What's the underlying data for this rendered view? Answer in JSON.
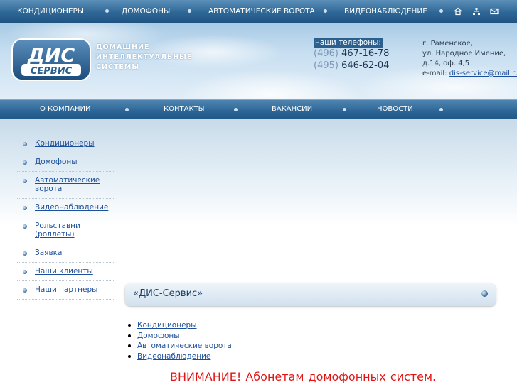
{
  "top_nav": {
    "items": [
      "КОНДИЦИОНЕРЫ",
      "ДОМОФОНЫ",
      "АВТОМАТИЧЕСКИЕ ВОРОТА",
      "ВИДЕОНАБЛЮДЕНИЕ"
    ],
    "icons": [
      "home-icon",
      "sitemap-icon",
      "mail-icon"
    ]
  },
  "header": {
    "logo_text_top": "ДИС",
    "logo_text_bottom": "СЕРВИС",
    "tagline": [
      "ДОМАШНИЕ",
      "ИНТЕЛЛЕКТУАЛЬНЫЕ",
      "СИСТЕМЫ"
    ],
    "phones_label": "наши телефоны:",
    "phones": [
      {
        "code": "(496)",
        "number": "467-16-78"
      },
      {
        "code": "(495)",
        "number": "646-62-04"
      }
    ],
    "address": [
      "г. Раменское,",
      "ул. Народное Имение,",
      "д.14, оф. 4,5"
    ],
    "email_label": "e-mail:",
    "email": "dis-service@mail.ru"
  },
  "sub_nav": {
    "items": [
      "О КОМПАНИИ",
      "КОНТАКТЫ",
      "ВАКАНСИИ",
      "НОВОСТИ"
    ]
  },
  "sidebar": {
    "items": [
      "Кондиционеры",
      "Домофоны",
      "Автоматические ворота",
      "Видеонаблюдение",
      "Рольставни (роллеты)",
      "Заявка",
      "Наши клиенты",
      "Наши партнеры"
    ]
  },
  "main": {
    "section_title": "«ДИС-Сервис»",
    "links": [
      "Кондиционеры",
      "Домофоны",
      "Автоматические ворота",
      "Видеонаблюдение"
    ],
    "notice": "ВНИМАНИЕ!  Абонетам домофонных систем."
  },
  "colors": {
    "nav_blue": "#2e6796",
    "link_blue": "#1d4f9a",
    "notice_red": "#e01515",
    "phone_label_bg": "#2b5f8e"
  }
}
